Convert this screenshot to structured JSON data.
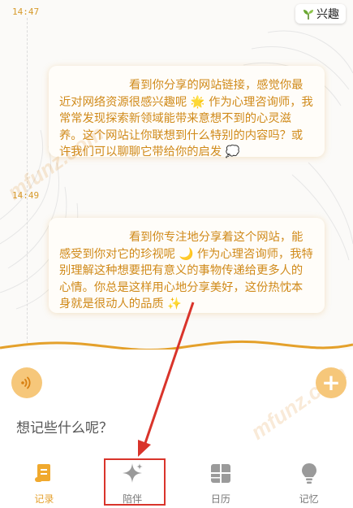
{
  "header": {
    "tag_label": "兴趣",
    "tag_icon": "sprout-icon"
  },
  "messages": [
    {
      "time": "14:47",
      "text": "看到你分享的网站链接，感觉你最近对网络资源很感兴趣呢 🌟 作为心理咨询师，我常常发现探索新领域能带来意想不到的心灵滋养。这个网站让你联想到什么特别的内容吗？或许我们可以聊聊它带给你的启发 💭"
    },
    {
      "time": "14:49",
      "text": "看到你专注地分享着这个网站，能感受到你对它的珍视呢 🌙 作为心理咨询师，我特别理解这种想要把有意义的事物传递给更多人的心情。你总是这样用心地分享美好，这份热忱本身就是很动人的品质 ✨"
    }
  ],
  "watermark": "mfunz.com",
  "composer": {
    "prompt": "想记些什么呢？",
    "voice_icon": "voice-waves-icon",
    "add_icon": "plus-icon"
  },
  "tabs": [
    {
      "label": "记录",
      "icon": "scroll-icon",
      "active": true
    },
    {
      "label": "陪伴",
      "icon": "sparkle-icon",
      "active": false
    },
    {
      "label": "日历",
      "icon": "calendar-grid-icon",
      "active": false
    },
    {
      "label": "记忆",
      "icon": "lightbulb-icon",
      "active": false
    }
  ],
  "colors": {
    "accent": "#e5a12e",
    "bubble_text": "#d08a1a",
    "annotation_red": "#d9342b"
  }
}
